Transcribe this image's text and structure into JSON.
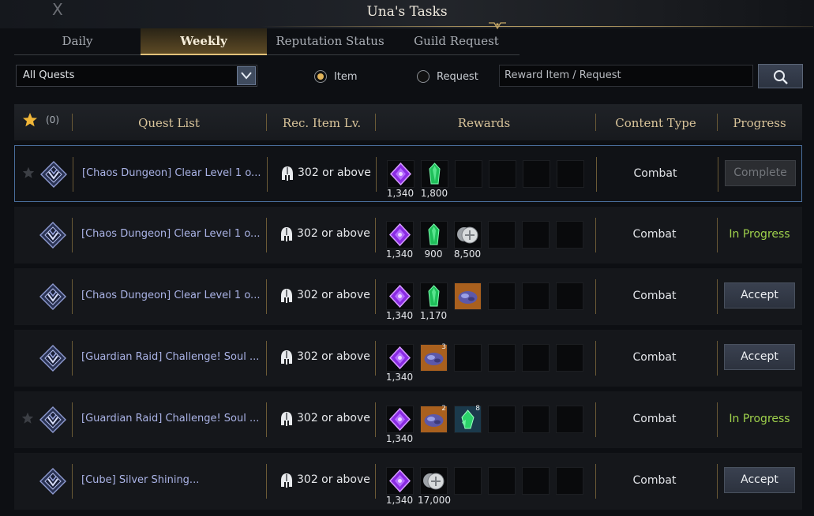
{
  "window": {
    "title": "Una's Tasks",
    "close_label": "X"
  },
  "tabs": [
    {
      "label": "Daily",
      "active": false
    },
    {
      "label": "Weekly",
      "active": true
    },
    {
      "label": "Reputation Status",
      "active": false
    },
    {
      "label": "Guild Request",
      "active": false
    }
  ],
  "filters": {
    "quest_filter": "All Quests",
    "radio_item": "Item",
    "radio_request": "Request",
    "selected": "Item",
    "search_placeholder": "Reward Item / Request"
  },
  "table": {
    "favorite_count": "(0)",
    "columns": {
      "quest_list": "Quest List",
      "rec_item_lv": "Rec. Item Lv.",
      "rewards": "Rewards",
      "content_type": "Content Type",
      "progress": "Progress"
    },
    "rows": [
      {
        "favorite": true,
        "name": "[Chaos Dungeon] Clear Level 1 o...",
        "level": "302 or above",
        "rewards": [
          {
            "icon": "purple-gem-icon",
            "amount": "1,340"
          },
          {
            "icon": "green-crystal-icon",
            "amount": "1,800"
          }
        ],
        "content_type": "Combat",
        "status": "Complete",
        "status_kind": "button-disabled"
      },
      {
        "favorite": false,
        "name": "[Chaos Dungeon] Clear Level 1 o...",
        "level": "302 or above",
        "rewards": [
          {
            "icon": "purple-gem-icon",
            "amount": "1,340"
          },
          {
            "icon": "green-crystal-icon",
            "amount": "900"
          },
          {
            "icon": "silver-coin-icon",
            "amount": "8,500"
          }
        ],
        "content_type": "Combat",
        "status": "In Progress",
        "status_kind": "text"
      },
      {
        "favorite": false,
        "name": "[Chaos Dungeon] Clear Level 1 o...",
        "level": "302 or above",
        "rewards": [
          {
            "icon": "purple-gem-icon",
            "amount": "1,340"
          },
          {
            "icon": "green-crystal-icon",
            "amount": "1,170"
          },
          {
            "icon": "ore-icon",
            "amount": ""
          }
        ],
        "content_type": "Combat",
        "status": "Accept",
        "status_kind": "button"
      },
      {
        "favorite": false,
        "name": "[Guardian Raid] Challenge! Soul ...",
        "level": "302 or above",
        "rewards": [
          {
            "icon": "purple-gem-icon",
            "amount": "1,340"
          },
          {
            "icon": "ore-icon",
            "amount": "",
            "badge": "3"
          }
        ],
        "content_type": "Combat",
        "status": "Accept",
        "status_kind": "button"
      },
      {
        "favorite": true,
        "name": "[Guardian Raid] Challenge! Soul ...",
        "level": "302 or above",
        "rewards": [
          {
            "icon": "purple-gem-icon",
            "amount": "1,340"
          },
          {
            "icon": "ore-icon",
            "amount": "",
            "badge": "2"
          },
          {
            "icon": "green-shard-icon",
            "amount": "",
            "badge": "8"
          }
        ],
        "content_type": "Combat",
        "status": "In Progress",
        "status_kind": "text"
      },
      {
        "favorite": false,
        "name": "[Cube] Silver Shining...",
        "level": "302 or above",
        "rewards": [
          {
            "icon": "purple-gem-icon",
            "amount": "1,340"
          },
          {
            "icon": "silver-coin-icon",
            "amount": "17,000"
          }
        ],
        "content_type": "Combat",
        "status": "Accept",
        "status_kind": "button"
      }
    ]
  },
  "colors": {
    "accent_gold": "#e2c27a",
    "in_progress": "#9ed04b",
    "quest_name": "#aab3e6",
    "selected_border": "#4a6e9c"
  }
}
